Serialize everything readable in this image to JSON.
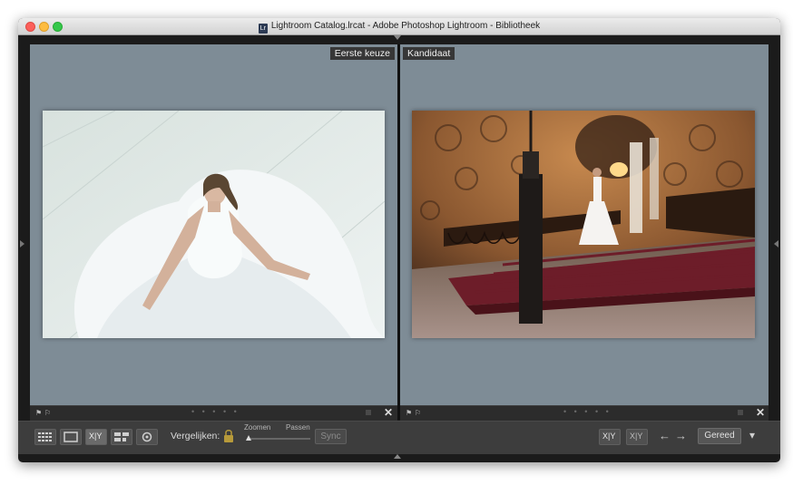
{
  "window": {
    "title": "Lightroom Catalog.lrcat - Adobe Photoshop Lightroom - Bibliotheek",
    "app_icon_text": "Lr"
  },
  "compare": {
    "select_label": "Eerste keuze",
    "candidate_label": "Kandidaat",
    "left_photo": "bride-in-white-dress-photo",
    "right_photo": "bride-on-grand-staircase-photo"
  },
  "strip": {
    "dots": "• • • • •",
    "close_symbol": "✕"
  },
  "toolbar": {
    "compare_label": "Vergelijken:",
    "zoom_label": "Zoomen",
    "fit_label": "Passen",
    "sync_label": "Sync",
    "done_label": "Gereed",
    "left_arrow": "←",
    "right_arrow": "→",
    "dropdown_arrow": "▾",
    "xy_label": "X|Y"
  },
  "colors": {
    "panel_bg": "#7e8c96",
    "window_bg": "#1b1b1b",
    "toolbar_bg": "#3d3d3d",
    "lock_color": "#b79a3a"
  }
}
